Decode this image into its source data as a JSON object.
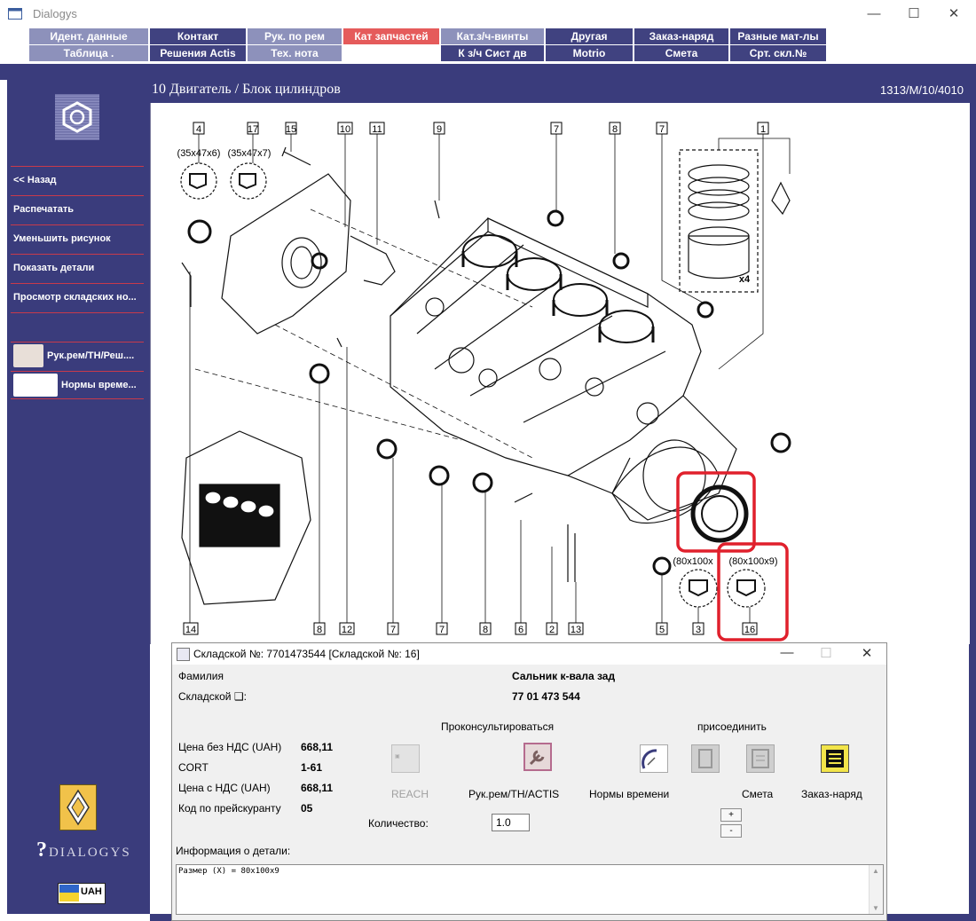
{
  "window": {
    "title": "Dialogys",
    "minimize": "—",
    "maximize": "☐",
    "close": "✕"
  },
  "tabs_row1": [
    "Идент. данные",
    "Контакт",
    "Рук. по рем",
    "Кат запчастей",
    "Кат.з/ч-винты",
    "Другая",
    "Заказ-наряд",
    "Разные мат-лы"
  ],
  "tabs_row2": [
    "Таблица .",
    "Решения Actis",
    "Тех. нота",
    "",
    "К з/ч Сист дв",
    "Motrio",
    "Смета",
    "Срт. скл.№"
  ],
  "active_tab": "Кат запчастей",
  "sidebar": {
    "items": [
      "<< Назад",
      "Распечатать",
      "Уменьшить рисунок",
      "Показать детали",
      "Просмотр складских но..."
    ],
    "shortcuts": [
      "Рук.рем/TH/Реш....",
      "Нормы време..."
    ],
    "logo_text": "DIALOGYS",
    "currency": "UAH"
  },
  "header": {
    "title": "10 Двигатель / Блок цилиндров",
    "code": "1313/M/10/4010"
  },
  "diagram": {
    "callouts_top": [
      "4",
      "17",
      "15",
      "10",
      "11",
      "9",
      "7",
      "8",
      "7",
      "1"
    ],
    "size_labels": [
      "(35x47x6)",
      "(35x47x7)",
      "(80x100x",
      "(80x100x9)"
    ],
    "callouts_bottom": [
      "14",
      "8",
      "12",
      "7",
      "7",
      "8",
      "6",
      "2",
      "13",
      "5",
      "3",
      "16"
    ],
    "qty_label": "x4",
    "highlight_color": "#e0202c"
  },
  "dialog": {
    "title": "Складской №: 7701473544 [Складской №: 16]",
    "family_label": "Фамилия",
    "family_value": "Сальник к-вала зад",
    "stock_label": "Складской ❑:",
    "stock_value": "77 01 473 544",
    "price_no_vat_label": "Цена без НДС (UAH)",
    "price_no_vat": "668,11",
    "cort_label": "CORT",
    "cort_value": "1-61",
    "price_vat_label": "Цена с НДС (UAH)",
    "price_vat": "668,11",
    "pricelist_label": "Код по прейскуранту",
    "pricelist_value": "05",
    "consult_label": "Проконсультироваться",
    "attach_label": "присоединить",
    "reach_label": "REACH",
    "actis_label": "Рук.рем/TH/ACTIS",
    "norms_label": "Нормы времени",
    "estimate_label": "Смета",
    "order_label": "Заказ-наряд",
    "qty_label": "Количество:",
    "qty_value": "1.0",
    "plus": "+",
    "minus": "-",
    "info_label": "Информация о детали:",
    "info_text": "Размер (X) = 80x100x9"
  }
}
